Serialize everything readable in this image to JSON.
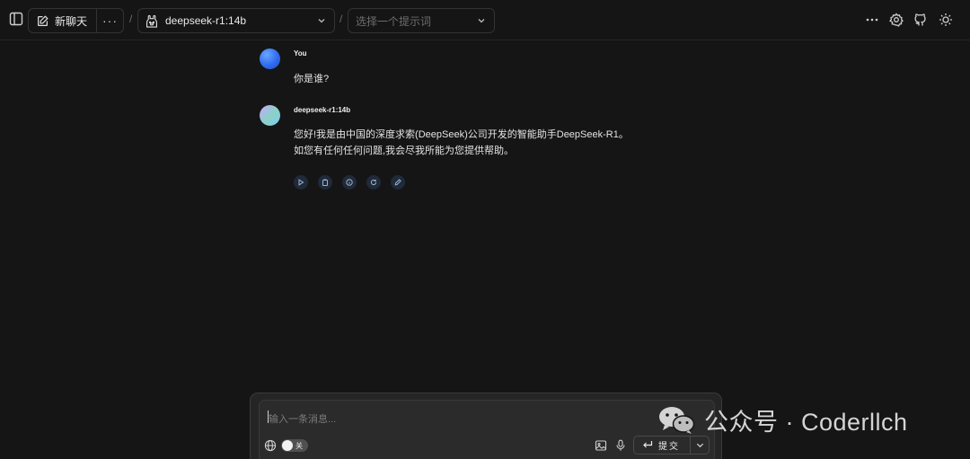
{
  "header": {
    "new_chat_label": "新聊天",
    "more_label": "···",
    "breadcrumb_sep": "/",
    "model_name": "deepseek-r1:14b",
    "prompt_placeholder": "选择一个提示词"
  },
  "messages": [
    {
      "sender": "You",
      "lines": [
        "你是谁?"
      ]
    },
    {
      "sender": "deepseek-r1:14b",
      "lines": [
        "您好!我是由中国的深度求索(DeepSeek)公司开发的智能助手DeepSeek-R1。",
        "如您有任何任何问题,我会尽我所能为您提供帮助。"
      ]
    }
  ],
  "composer": {
    "placeholder": "输入一条消息...",
    "web_toggle_label": "关",
    "submit_label": "提交"
  },
  "watermark": {
    "text": "公众号 · Coderllch"
  },
  "colors": {
    "background": "#151515",
    "panel": "#2b2b2b",
    "user_avatar": "#2f6bf0"
  }
}
